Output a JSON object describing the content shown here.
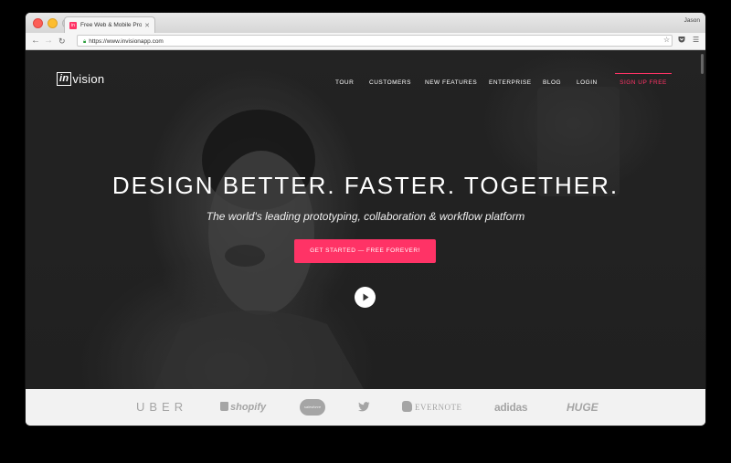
{
  "browser": {
    "tab_title": "Free Web & Mobile Protot",
    "tab_favicon": "in",
    "profile_name": "Jason",
    "url": "https://www.invisionapp.com"
  },
  "site": {
    "logo_prefix": "in",
    "logo_suffix": "vision",
    "nav": [
      "TOUR",
      "CUSTOMERS",
      "NEW FEATURES",
      "ENTERPRISE",
      "BLOG",
      "LOGIN"
    ],
    "signup_label": "SIGN UP FREE",
    "headline": "DESIGN BETTER. FASTER. TOGETHER.",
    "subheadline": "The world's leading prototyping, collaboration & workflow platform",
    "cta_label": "GET STARTED — FREE FOREVER!",
    "brands": [
      "UBER",
      "shopify",
      "salesforce",
      "twitter",
      "EVERNOTE",
      "adidas",
      "HUGE"
    ]
  },
  "colors": {
    "accent": "#ff3366",
    "hero_bg": "#2a2a2a",
    "logos_bg": "#f2f2f2",
    "brand_gray": "#a5a5a5"
  },
  "icons": {
    "back": "back-arrow-icon",
    "forward": "forward-arrow-icon",
    "reload": "reload-icon",
    "lock": "lock-icon",
    "star": "star-icon",
    "pocket": "pocket-icon",
    "menu": "hamburger-menu-icon",
    "play": "play-icon",
    "twitter_bird": "twitter-bird-icon",
    "evernote_elephant": "evernote-elephant-icon",
    "shopify_bag": "shopify-bag-icon"
  }
}
